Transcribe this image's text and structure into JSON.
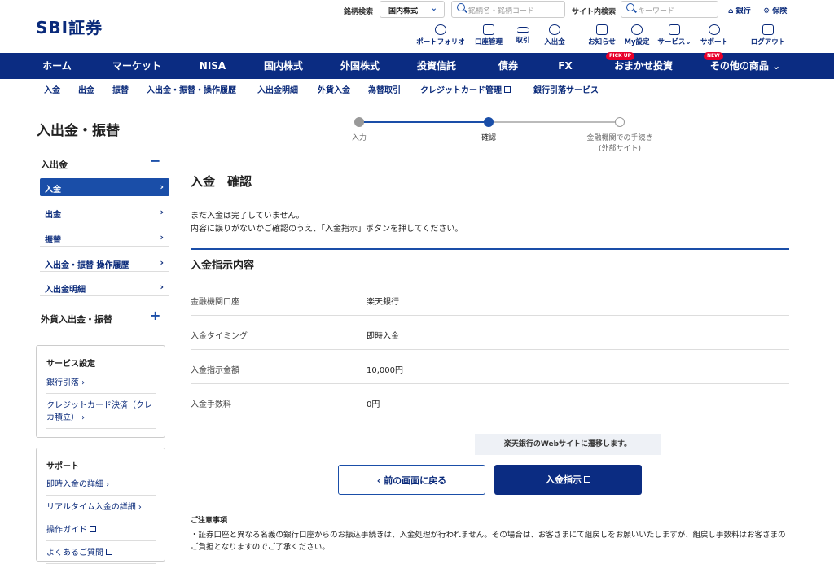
{
  "header": {
    "logo": "SBI証券",
    "stock_search_label": "銘柄検索",
    "market_select": "国内株式",
    "stock_search_placeholder": "銘柄名・銘柄コード",
    "site_search_label": "サイト内検索",
    "site_search_placeholder": "キーワード",
    "bank_link": "銀行",
    "insurance_link": "保険",
    "icon_nav": [
      {
        "label": "ポートフォリオ",
        "icon": "portfolio-icon"
      },
      {
        "label": "口座管理",
        "icon": "account-icon"
      },
      {
        "label": "取引",
        "icon": "trade-icon"
      },
      {
        "label": "入出金",
        "icon": "deposit-icon"
      },
      {
        "label": "お知らせ",
        "icon": "notice-icon"
      },
      {
        "label": "My設定",
        "icon": "settings-icon"
      },
      {
        "label": "サービス",
        "icon": "service-icon"
      },
      {
        "label": "サポート",
        "icon": "support-icon"
      },
      {
        "label": "ログアウト",
        "icon": "logout-icon"
      }
    ]
  },
  "main_nav": {
    "items": [
      "ホーム",
      "マーケット",
      "NISA",
      "国内株式",
      "外国株式",
      "投資信託",
      "債券",
      "FX",
      "おまかせ投資",
      "その他の商品"
    ],
    "badges": {
      "pickup": "PICK UP",
      "new": "NEW"
    }
  },
  "sub_nav": {
    "items": [
      "入金",
      "出金",
      "振替",
      "入出金・振替・操作履歴",
      "入出金明細",
      "外貨入金",
      "為替取引",
      "クレジットカード管理",
      "銀行引落サービス"
    ]
  },
  "sidebar": {
    "title": "入出金・振替",
    "section1": "入出金",
    "section1_items": [
      "入金",
      "出金",
      "振替",
      "入出金・振替 操作履歴",
      "入出金明細"
    ],
    "section2": "外貨入出金・振替",
    "service_box": {
      "title": "サービス設定",
      "links": [
        "銀行引落",
        "クレジットカード決済（クレカ積立）"
      ]
    },
    "support_box": {
      "title": "サポート",
      "links": [
        "即時入金の詳細",
        "リアルタイム入金の詳細",
        "操作ガイド",
        "よくあるご質問"
      ]
    }
  },
  "steps": {
    "step1": "入力",
    "step2": "確認",
    "step3_line1": "金融機関での手続き",
    "step3_line2": "(外部サイト)"
  },
  "page": {
    "title": "入金　確認",
    "msg1": "まだ入金は完了していません。",
    "msg2": "内容に誤りがないかご確認のうえ、「入金指示」ボタンを押してください。",
    "section_title": "入金指示内容",
    "rows": [
      {
        "k": "金融機関口座",
        "v": "楽天銀行"
      },
      {
        "k": "入金タイミング",
        "v": "即時入金"
      },
      {
        "k": "入金指示金額",
        "v": "10,000円"
      },
      {
        "k": "入金手数料",
        "v": "0円"
      }
    ],
    "redirect_note": "楽天銀行のWebサイトに遷移します。",
    "back_button": "前の画面に戻る",
    "submit_button": "入金指示",
    "caution_title": "ご注意事項",
    "caution_text": "・証券口座と異なる名義の銀行口座からのお振込手続きは、入金処理が行われません。その場合は、お客さまにて組戻しをお願いいたしますが、組戻し手数料はお客さまのご負担となりますのでご了承ください。"
  },
  "colors": {
    "navy": "#0b2c82",
    "accent": "#1a4ea8"
  }
}
